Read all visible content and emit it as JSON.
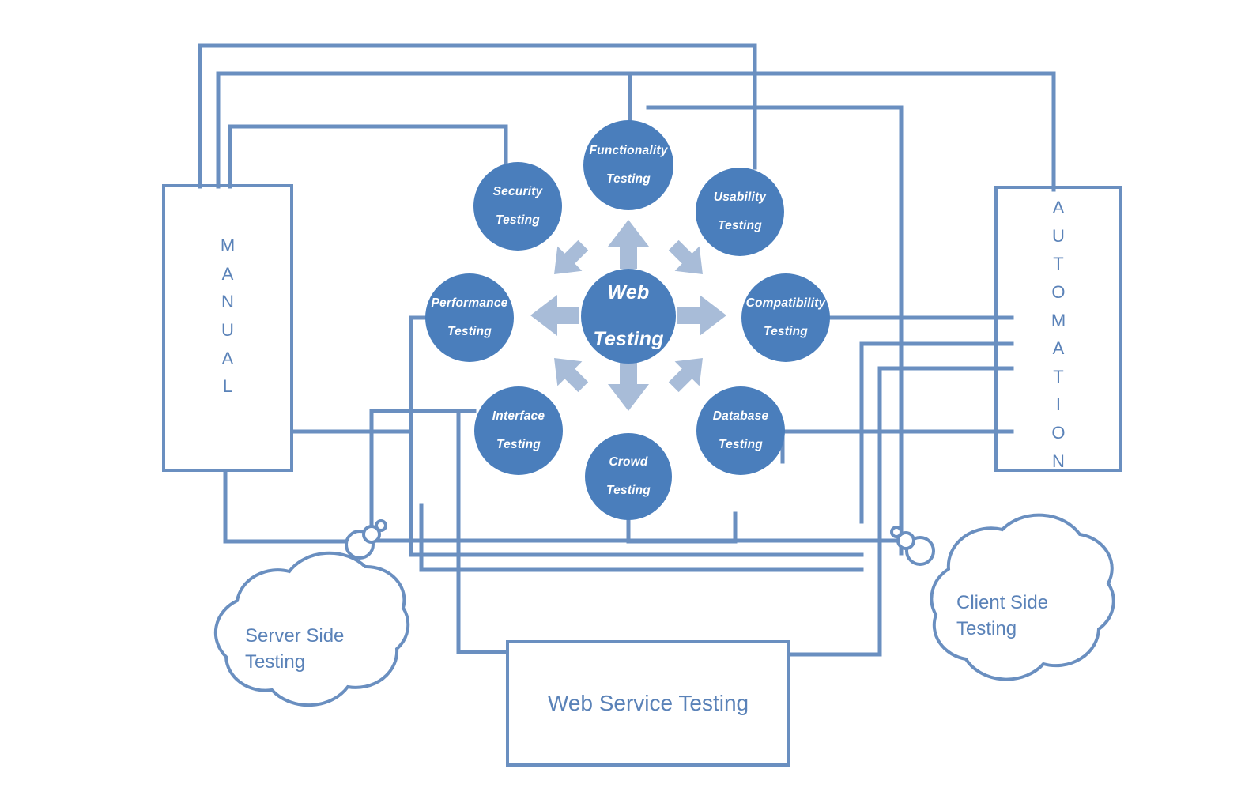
{
  "diagram": {
    "title": "Web Testing",
    "center": {
      "label": "Web Testing",
      "line1": "Web",
      "line2": "Testing"
    },
    "satellites": [
      {
        "id": "functionality",
        "line1": "Functionality",
        "line2": "Testing",
        "label": "Functionality Testing"
      },
      {
        "id": "usability",
        "line1": "Usability",
        "line2": "Testing",
        "label": "Usability Testing"
      },
      {
        "id": "compatibility",
        "line1": "Compatibility",
        "line2": "Testing",
        "label": "Compatibility Testing"
      },
      {
        "id": "database",
        "line1": "Database",
        "line2": "Testing",
        "label": "Database Testing"
      },
      {
        "id": "crowd",
        "line1": "Crowd",
        "line2": "Testing",
        "label": "Crowd Testing"
      },
      {
        "id": "interface",
        "line1": "Interface",
        "line2": "Testing",
        "label": "Interface Testing"
      },
      {
        "id": "performance",
        "line1": "Performance",
        "line2": "Testing",
        "label": "Performance Testing"
      },
      {
        "id": "security",
        "line1": "Security",
        "line2": "Testing",
        "label": "Security Testing"
      }
    ],
    "boxes": {
      "manual": {
        "label": "MANUAL",
        "orientation": "vertical"
      },
      "automation": {
        "label": "AUTOMATION",
        "orientation": "vertical"
      },
      "web_service": {
        "label": "Web Service Testing",
        "orientation": "horizontal"
      }
    },
    "clouds": [
      {
        "id": "server-side",
        "line1": "Server Side",
        "line2": "Testing",
        "label": "Server Side Testing"
      },
      {
        "id": "client-side",
        "line1": "Client Side",
        "line2": "Testing",
        "label": "Client Side Testing"
      }
    ],
    "colors": {
      "circle_fill": "#4a7ebc",
      "circle_text": "#ffffff",
      "connector": "#6a8fc0",
      "arrow": "#a8bcd8",
      "box_text": "#5a82b8",
      "background": "#ffffff"
    }
  }
}
